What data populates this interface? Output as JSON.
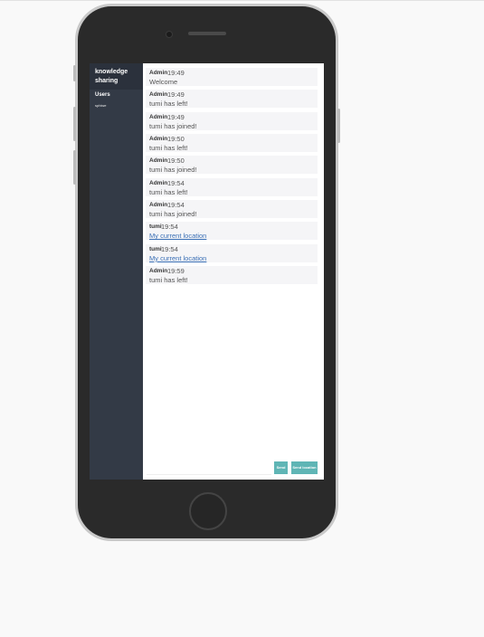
{
  "sidebar": {
    "title": "knowledge sharing",
    "users_heading": "Users",
    "users": [
      "sphiwe"
    ]
  },
  "messages": [
    {
      "name": "Admin",
      "time": "19:49",
      "text": "Welcome",
      "is_link": false
    },
    {
      "name": "Admin",
      "time": "19:49",
      "text": "tumi has left!",
      "is_link": false
    },
    {
      "name": "Admin",
      "time": "19:49",
      "text": "tumi has joined!",
      "is_link": false
    },
    {
      "name": "Admin",
      "time": "19:50",
      "text": "tumi has left!",
      "is_link": false
    },
    {
      "name": "Admin",
      "time": "19:50",
      "text": "tumi has joined!",
      "is_link": false
    },
    {
      "name": "Admin",
      "time": "19:54",
      "text": "tumi has left!",
      "is_link": false
    },
    {
      "name": "Admin",
      "time": "19:54",
      "text": "tumi has joined!",
      "is_link": false
    },
    {
      "name": "tumi",
      "time": "19:54",
      "text": "My current location",
      "is_link": true
    },
    {
      "name": "tumi",
      "time": "19:54",
      "text": "My current location",
      "is_link": true
    },
    {
      "name": "Admin",
      "time": "19:59",
      "text": "tumi has left!",
      "is_link": false
    }
  ],
  "compose": {
    "placeholder": "",
    "send_label": "Send",
    "send_location_label": "Send location"
  },
  "colors": {
    "sidebar": "#333a46",
    "sidebar_title": "#2b313c",
    "message_bg": "#f5f5f7",
    "button": "#5fb5b5",
    "link": "#3a6fb5"
  }
}
